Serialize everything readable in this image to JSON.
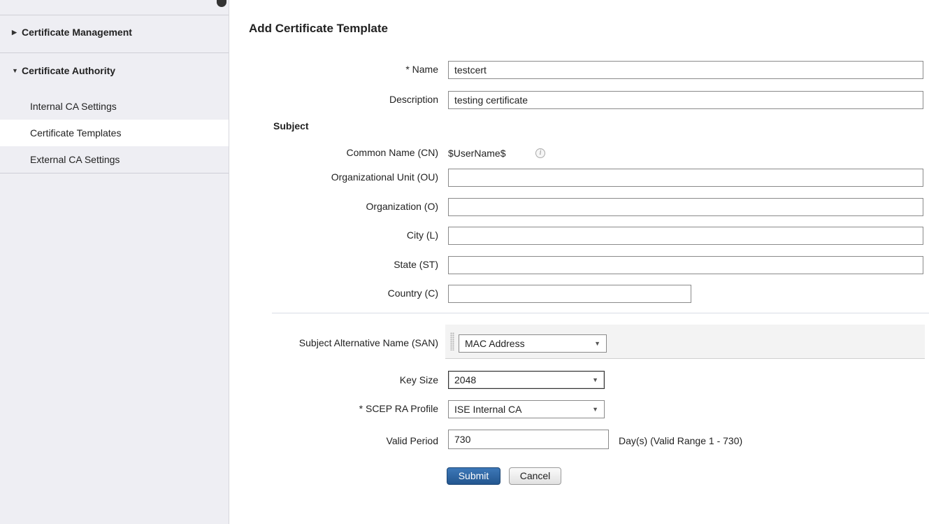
{
  "sidebar": {
    "groups": [
      {
        "label": "Certificate Management",
        "expanded": false,
        "caret": "triangle-right-icon"
      },
      {
        "label": "Certificate Authority",
        "expanded": true,
        "caret": "triangle-down-icon"
      }
    ],
    "items": [
      {
        "label": "Internal CA Settings",
        "active": false
      },
      {
        "label": "Certificate Templates",
        "active": true
      },
      {
        "label": "External CA Settings",
        "active": false
      }
    ]
  },
  "page": {
    "title": "Add Certificate Template"
  },
  "form": {
    "name": {
      "label": "* Name",
      "value": "testcert"
    },
    "description": {
      "label": "Description",
      "value": "testing certificate"
    },
    "subject_heading": "Subject",
    "common_name": {
      "label": "Common Name (CN)",
      "value": "$UserName$",
      "icon": "info-icon"
    },
    "ou": {
      "label": "Organizational Unit (OU)",
      "value": ""
    },
    "org": {
      "label": "Organization (O)",
      "value": ""
    },
    "city": {
      "label": "City (L)",
      "value": ""
    },
    "state": {
      "label": "State (ST)",
      "value": ""
    },
    "country": {
      "label": "Country (C)",
      "value": ""
    },
    "san": {
      "label": "Subject Alternative Name (SAN)",
      "selected": "MAC Address"
    },
    "key_size": {
      "label": "Key Size",
      "selected": "2048"
    },
    "scep": {
      "label": "* SCEP RA Profile",
      "selected": "ISE Internal CA"
    },
    "valid_period": {
      "label": "Valid Period",
      "value": "730",
      "helper": "Day(s) (Valid Range 1 - 730)"
    }
  },
  "buttons": {
    "submit": "Submit",
    "cancel": "Cancel"
  },
  "colors": {
    "primary_button": "#2d64a3",
    "sidebar_bg": "#eeeef3"
  }
}
